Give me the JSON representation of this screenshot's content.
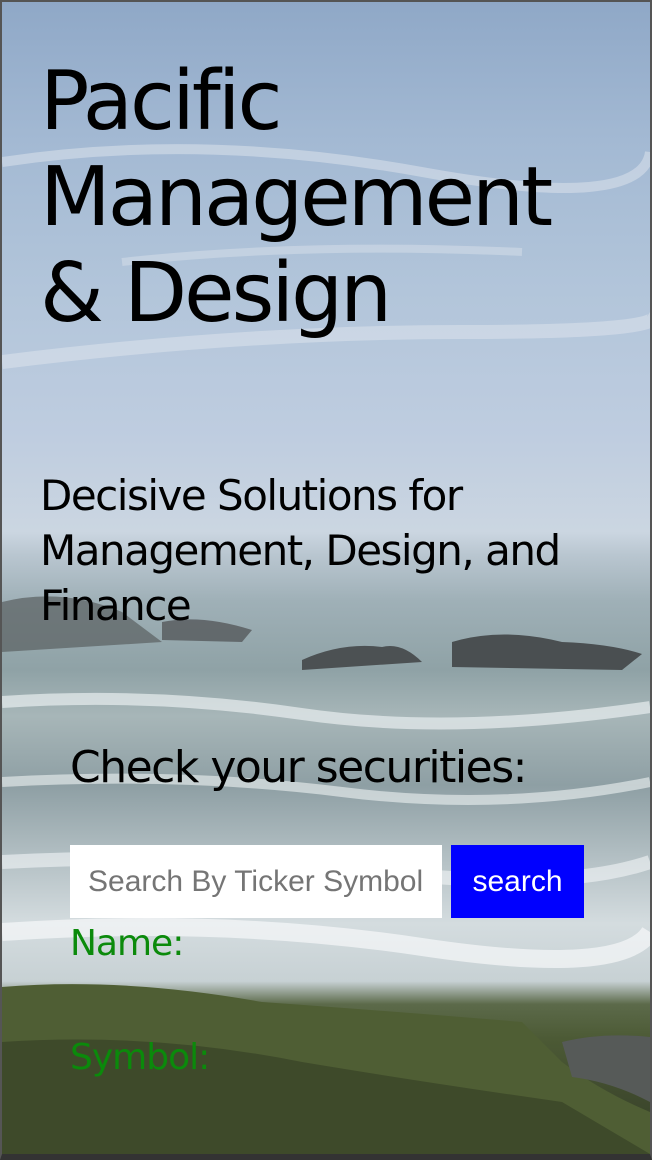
{
  "hero": {
    "title": "Pacific Management & Design",
    "tagline": "Decisive Solutions for Management, Design, and Finance"
  },
  "securities": {
    "heading": "Check your securities:",
    "search_placeholder": "Search By Ticker Symbol",
    "search_button_label": "search",
    "name_label": "Name:",
    "symbol_label": "Symbol:"
  },
  "colors": {
    "search_button_bg": "#0000ff",
    "result_label": "#0b8a0b"
  }
}
